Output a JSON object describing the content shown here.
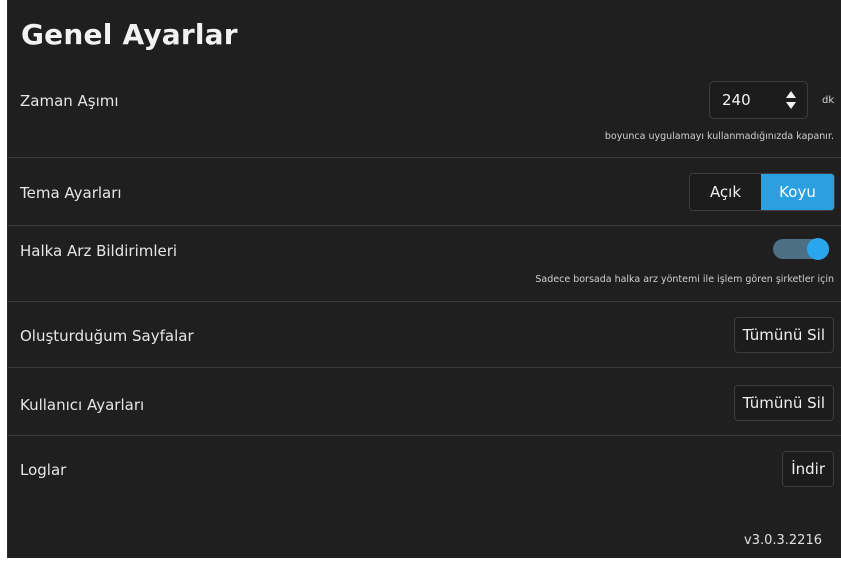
{
  "page_title": "Genel Ayarlar",
  "timeout": {
    "label": "Zaman Aşımı",
    "value": "240",
    "unit": "dk",
    "hint": "boyunca uygulamayı kullanmadığınızda kapanır."
  },
  "theme": {
    "label": "Tema Ayarları",
    "options": [
      "Açık",
      "Koyu"
    ],
    "selected": "Koyu"
  },
  "ipo_notifications": {
    "label": "Halka Arz Bildirimleri",
    "enabled": true,
    "hint": "Sadece borsada halka arz yöntemi ile işlem gören şirketler için"
  },
  "my_pages": {
    "label": "Oluşturduğum Sayfalar",
    "button": "Tümünü Sil"
  },
  "user_settings": {
    "label": "Kullanıcı Ayarları",
    "button": "Tümünü Sil"
  },
  "logs": {
    "label": "Loglar",
    "button": "İndir"
  },
  "version": "v3.0.3.2216",
  "colors": {
    "background": "#1f1f1f",
    "accent": "#2aa0e0",
    "divider": "#3a3a3a"
  },
  "icons": [
    "spinner-up-icon",
    "spinner-down-icon",
    "toggle-switch"
  ]
}
